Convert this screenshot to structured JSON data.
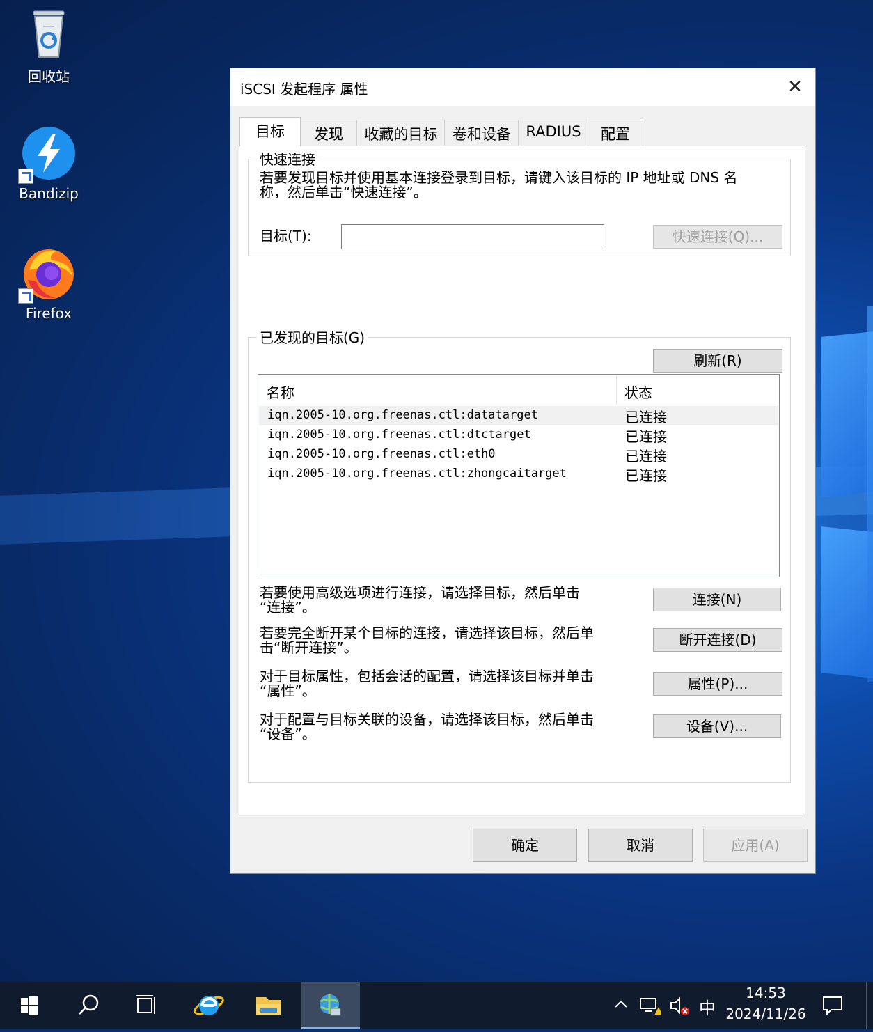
{
  "desktop": {
    "icons": [
      {
        "label": "回收站",
        "icon": "recycle-bin-icon"
      },
      {
        "label": "Bandizip",
        "icon": "bandizip-icon"
      },
      {
        "label": "Firefox",
        "icon": "firefox-icon"
      }
    ]
  },
  "dialog": {
    "title": "iSCSI 发起程序 属性",
    "close_glyph": "✕",
    "tabs": [
      {
        "label": "目标"
      },
      {
        "label": "发现"
      },
      {
        "label": "收藏的目标"
      },
      {
        "label": "卷和设备"
      },
      {
        "label": "RADIUS"
      },
      {
        "label": "配置"
      }
    ],
    "active_tab": "目标",
    "quick_connect": {
      "legend": "快速连接",
      "description_line1": "若要发现目标并使用基本连接登录到目标，请键入该目标的 IP 地址或 DNS 名",
      "description_line2": "称，然后单击“快速连接”。",
      "target_label": "目标(T):",
      "target_value": "",
      "quick_connect_button": "快速连接(Q)..."
    },
    "discovered": {
      "legend": "已发现的目标(G)",
      "refresh_button": "刷新(R)",
      "columns": [
        "名称",
        "状态"
      ],
      "rows": [
        {
          "name": "iqn.2005-10.org.freenas.ctl:datatarget",
          "status": "已连接"
        },
        {
          "name": "iqn.2005-10.org.freenas.ctl:dtctarget",
          "status": "已连接"
        },
        {
          "name": "iqn.2005-10.org.freenas.ctl:eth0",
          "status": "已连接"
        },
        {
          "name": "iqn.2005-10.org.freenas.ctl:zhongcaitarget",
          "status": "已连接"
        }
      ],
      "actions": [
        {
          "line1": "若要使用高级选项进行连接，请选择目标，然后单击",
          "line2": "“连接”。",
          "button": "连接(N)"
        },
        {
          "line1": "若要完全断开某个目标的连接，请选择该目标，然后单",
          "line2": "击“断开连接”。",
          "button": "断开连接(D)"
        },
        {
          "line1": "对于目标属性，包括会话的配置，请选择该目标并单击",
          "line2": "“属性”。",
          "button": "属性(P)..."
        },
        {
          "line1": "对于配置与目标关联的设备，请选择该目标，然后单击",
          "line2": "“设备”。",
          "button": "设备(V)..."
        }
      ]
    },
    "footer": {
      "ok": "确定",
      "cancel": "取消",
      "apply": "应用(A)"
    }
  },
  "taskbar": {
    "items": [
      {
        "icon": "start-windows-icon"
      },
      {
        "icon": "search-icon"
      },
      {
        "icon": "task-view-icon"
      },
      {
        "icon": "internet-explorer-icon"
      },
      {
        "icon": "file-explorer-icon"
      },
      {
        "icon": "iscsi-initiator-icon"
      }
    ],
    "tray": {
      "ime": "中",
      "time": "14:53",
      "date": "2024/11/26"
    }
  }
}
